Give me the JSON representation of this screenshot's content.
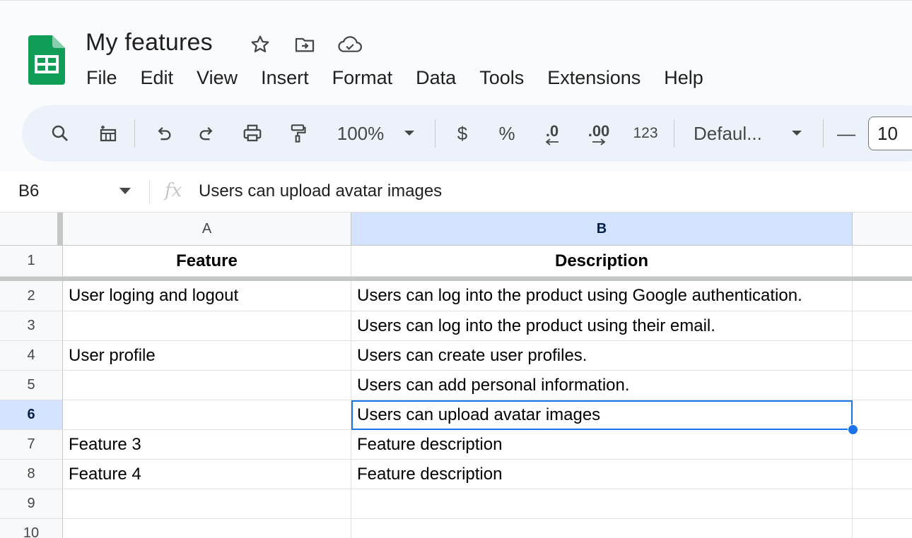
{
  "document": {
    "title": "My features"
  },
  "menu": [
    "File",
    "Edit",
    "View",
    "Insert",
    "Format",
    "Data",
    "Tools",
    "Extensions",
    "Help"
  ],
  "toolbar": {
    "zoom": "100%",
    "currency": "$",
    "percent": "%",
    "decrease_decimal": ".0",
    "increase_decimal": ".00",
    "number_format": "123",
    "font": "Defaul...",
    "font_size_minus": "—",
    "font_size": "10"
  },
  "formula_bar": {
    "cell_ref": "B6",
    "fx": "fx",
    "value": "Users can upload avatar images"
  },
  "columns": [
    "A",
    "B"
  ],
  "rows": [
    {
      "num": "1",
      "a": "Feature",
      "b": "Description"
    },
    {
      "num": "2",
      "a": "User loging and logout",
      "b": "Users can log into the product using Google authentication."
    },
    {
      "num": "3",
      "a": "",
      "b": "Users can log into the product using their email."
    },
    {
      "num": "4",
      "a": "User profile",
      "b": "Users can create user profiles."
    },
    {
      "num": "5",
      "a": "",
      "b": "Users can add personal information."
    },
    {
      "num": "6",
      "a": "",
      "b": "Users can upload avatar images"
    },
    {
      "num": "7",
      "a": "Feature 3",
      "b": "Feature description"
    },
    {
      "num": "8",
      "a": "Feature 4",
      "b": "Feature description"
    },
    {
      "num": "9",
      "a": "",
      "b": ""
    },
    {
      "num": "10",
      "a": "",
      "b": ""
    }
  ],
  "colors": {
    "accent": "#1a73e8",
    "selected_header": "#d3e3fd",
    "sheets_green": "#0f9d58"
  }
}
